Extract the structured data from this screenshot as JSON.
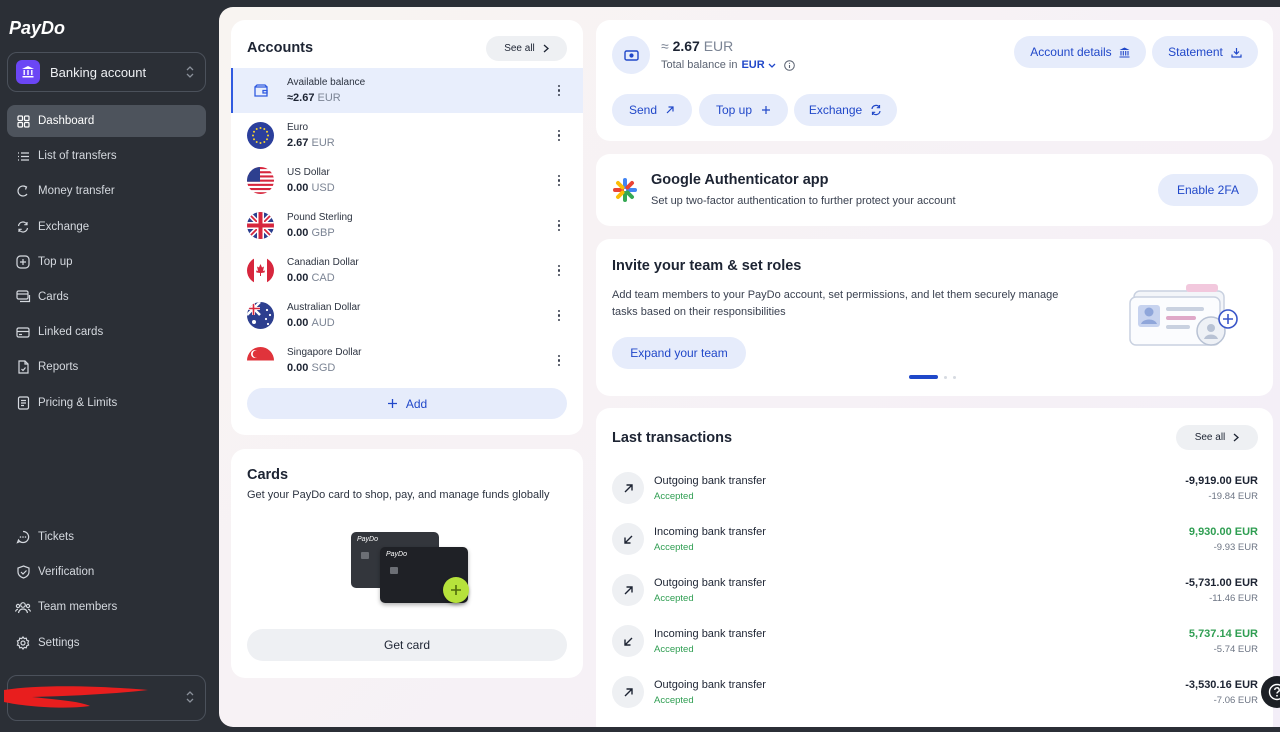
{
  "sidebar": {
    "logo": "PayDo",
    "account_switch": "Banking account",
    "nav": [
      {
        "label": "Dashboard",
        "icon": "grid-icon",
        "active": true
      },
      {
        "label": "List of transfers",
        "icon": "list-icon"
      },
      {
        "label": "Money transfer",
        "icon": "transfer-icon"
      },
      {
        "label": "Exchange",
        "icon": "exchange-icon"
      },
      {
        "label": "Top up",
        "icon": "plus-square-icon"
      },
      {
        "label": "Cards",
        "icon": "cards-icon"
      },
      {
        "label": "Linked cards",
        "icon": "linked-cards-icon"
      },
      {
        "label": "Reports",
        "icon": "report-icon"
      },
      {
        "label": "Pricing & Limits",
        "icon": "pricing-icon"
      }
    ],
    "bottom_nav": [
      {
        "label": "Tickets",
        "icon": "chat-icon"
      },
      {
        "label": "Verification",
        "icon": "shield-check-icon"
      },
      {
        "label": "Team members",
        "icon": "team-icon"
      },
      {
        "label": "Settings",
        "icon": "gear-icon"
      }
    ]
  },
  "accounts": {
    "title": "Accounts",
    "see_all": "See all",
    "add": "Add",
    "items": [
      {
        "name": "Available balance",
        "amount": "≈2.67",
        "currency": "EUR",
        "flag": "wallet"
      },
      {
        "name": "Euro",
        "amount": "2.67",
        "currency": "EUR",
        "flag": "eu"
      },
      {
        "name": "US Dollar",
        "amount": "0.00",
        "currency": "USD",
        "flag": "us"
      },
      {
        "name": "Pound Sterling",
        "amount": "0.00",
        "currency": "GBP",
        "flag": "gb"
      },
      {
        "name": "Canadian Dollar",
        "amount": "0.00",
        "currency": "CAD",
        "flag": "ca"
      },
      {
        "name": "Australian Dollar",
        "amount": "0.00",
        "currency": "AUD",
        "flag": "au"
      },
      {
        "name": "Singapore Dollar",
        "amount": "0.00",
        "currency": "SGD",
        "flag": "sg"
      }
    ]
  },
  "cards_promo": {
    "title": "Cards",
    "subtitle": "Get your PayDo card to shop, pay, and manage funds globally",
    "card_brand": "PayDo",
    "button": "Get card"
  },
  "balance": {
    "prefix": "≈",
    "amount": "2.67",
    "currency": "EUR",
    "label": "Total balance in",
    "label_currency": "EUR",
    "account_details": "Account details",
    "statement": "Statement",
    "send": "Send",
    "top_up": "Top up",
    "exchange": "Exchange"
  },
  "authenticator": {
    "title": "Google Authenticator app",
    "subtitle": "Set up two-factor authentication to further protect your account",
    "button": "Enable 2FA"
  },
  "invite": {
    "title": "Invite your team & set roles",
    "text_line1": "Add team members to your PayDo account, set permissions, and let them securely manage",
    "text_line2": "tasks based on their responsibilities",
    "button": "Expand your team"
  },
  "transactions": {
    "title": "Last transactions",
    "see_all": "See all",
    "items": [
      {
        "title": "Outgoing bank transfer",
        "status": "Accepted",
        "amount": "-9,919.00 EUR",
        "fee": "-19.84 EUR",
        "direction": "out"
      },
      {
        "title": "Incoming bank transfer",
        "status": "Accepted",
        "amount": "9,930.00 EUR",
        "fee": "-9.93 EUR",
        "direction": "in"
      },
      {
        "title": "Outgoing bank transfer",
        "status": "Accepted",
        "amount": "-5,731.00 EUR",
        "fee": "-11.46 EUR",
        "direction": "out"
      },
      {
        "title": "Incoming bank transfer",
        "status": "Accepted",
        "amount": "5,737.14 EUR",
        "fee": "-5.74 EUR",
        "direction": "in"
      },
      {
        "title": "Outgoing bank transfer",
        "status": "Accepted",
        "amount": "-3,530.16 EUR",
        "fee": "-7.06 EUR",
        "direction": "out"
      }
    ]
  },
  "colors": {
    "accent": "#2148c9",
    "positive": "#2f9e52",
    "sidebar": "#2b2f36"
  }
}
